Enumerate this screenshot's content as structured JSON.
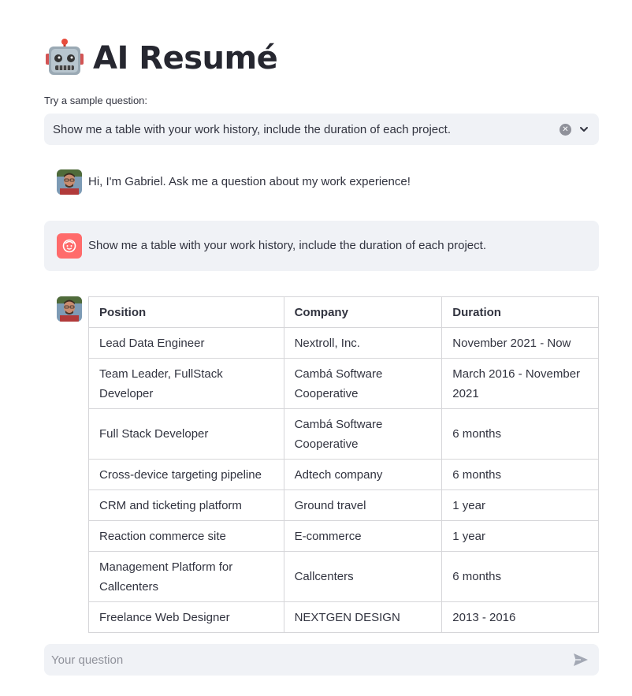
{
  "app": {
    "title": "AI Resumé",
    "title_icon": "robot-face-icon"
  },
  "sample": {
    "label": "Try a sample question:",
    "selected": "Show me a table with your work history, include the duration of each project."
  },
  "messages": [
    {
      "role": "assistant",
      "text": "Hi, I'm Gabriel. Ask me a question about my work experience!"
    },
    {
      "role": "user",
      "text": "Show me a table with your work history, include the duration of each project."
    }
  ],
  "work_history": {
    "headers": [
      "Position",
      "Company",
      "Duration"
    ],
    "rows": [
      [
        "Lead Data Engineer",
        "Nextroll, Inc.",
        "November 2021 - Now"
      ],
      [
        "Team Leader, FullStack Developer",
        "Cambá Software Cooperative",
        "March 2016 - November 2021"
      ],
      [
        "Full Stack Developer",
        "Cambá Software Cooperative",
        "6 months"
      ],
      [
        "Cross-device targeting pipeline",
        "Adtech company",
        "6 months"
      ],
      [
        "CRM and ticketing platform",
        "Ground travel",
        "1 year"
      ],
      [
        "Reaction commerce site",
        "E-commerce",
        "1 year"
      ],
      [
        "Management Platform for Callcenters",
        "Callcenters",
        "6 months"
      ],
      [
        "Freelance Web Designer",
        "NEXTGEN DESIGN",
        "2013 - 2016"
      ]
    ]
  },
  "chat_input": {
    "placeholder": "Your question"
  },
  "colors": {
    "panel": "#f0f2f6",
    "user_avatar": "#ff6b6b",
    "text": "#31333f",
    "border": "#d6d6d9"
  }
}
